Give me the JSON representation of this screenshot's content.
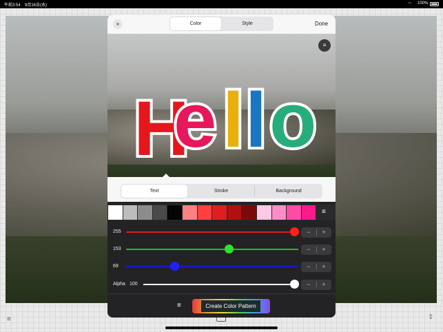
{
  "status_bar": {
    "time": "午前3:54",
    "date": "9月16日(水)",
    "battery": "100%"
  },
  "header": {
    "tabs": [
      {
        "label": "Color",
        "active": true
      },
      {
        "label": "Style",
        "active": false
      }
    ],
    "done_label": "Done"
  },
  "preview": {
    "text": "Hello",
    "letter_colors": [
      "#e4171c",
      "#e6175a",
      "#e9b00c",
      "#1876c2",
      "#27ad7c"
    ]
  },
  "color_target_tabs": [
    {
      "label": "Text",
      "active": true
    },
    {
      "label": "Stroke",
      "active": false
    },
    {
      "label": "Background",
      "active": false
    }
  ],
  "swatches": [
    "#ffffff",
    "#bdbdbd",
    "#8c8c8c",
    "#4a4a4a",
    "#050505",
    "#ff8080",
    "#ff4040",
    "#e01e1e",
    "#b01010",
    "#7a0a0a",
    "#ffc8e6",
    "#ff8cc8",
    "#ff4ca6",
    "#ff1a8c"
  ],
  "sliders": [
    {
      "name": "red",
      "label": "",
      "value": "255",
      "fraction": 1.0,
      "track_color": "#e01a1a",
      "thumb_color": "#ff2020"
    },
    {
      "name": "green",
      "label": "",
      "value": "153",
      "fraction": 0.6,
      "track_color": "#1ec01e",
      "thumb_color": "#30e030"
    },
    {
      "name": "blue",
      "label": "",
      "value": "69",
      "fraction": 0.27,
      "track_color": "#1a1ad0",
      "thumb_color": "#2020ff"
    },
    {
      "name": "alpha",
      "label": "Alpha",
      "value": "100",
      "fraction": 1.0,
      "track_color": "#ffffff",
      "thumb_color": "#ffffff"
    }
  ],
  "stepper": {
    "minus": "−",
    "plus": "+"
  },
  "footer": {
    "create_label": "Create Color Pattern"
  },
  "icons": {
    "close": "×",
    "menu": "≡"
  }
}
